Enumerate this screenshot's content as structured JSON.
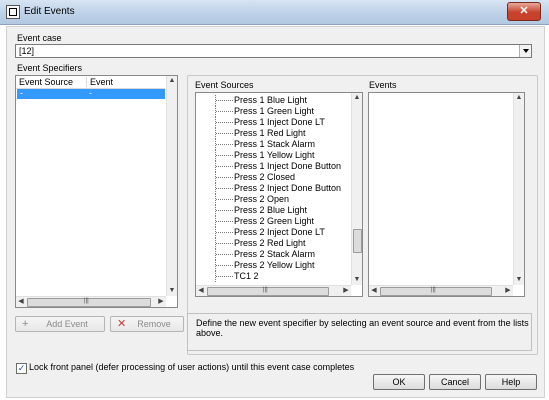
{
  "window": {
    "title": "Edit Events",
    "close_glyph": "✕"
  },
  "event_case": {
    "label": "Event case",
    "value": "[12]"
  },
  "event_specifiers": {
    "label": "Event Specifiers",
    "columns": [
      "Event Source",
      "Event"
    ],
    "rows": [
      {
        "source": "-",
        "event": "-"
      }
    ]
  },
  "event_sources": {
    "label": "Event Sources",
    "items": [
      "Press 1 Blue Light",
      "Press 1 Green Light",
      "Press 1 Inject Done LT",
      "Press 1 Red Light",
      "Press 1 Stack Alarm",
      "Press 1 Yellow Light",
      "Press 1 Inject Done Button",
      "Press 2 Closed",
      "Press 2 Inject Done Button",
      "Press 2 Open",
      "Press 2 Blue Light",
      "Press 2 Green Light",
      "Press 2 Inject Done LT",
      "Press 2 Red Light",
      "Press 2 Stack Alarm",
      "Press 2 Yellow Light",
      "TC1 2"
    ]
  },
  "events": {
    "label": "Events"
  },
  "buttons": {
    "add_event": "Add Event",
    "remove": "Remove",
    "ok": "OK",
    "cancel": "Cancel",
    "help": "Help"
  },
  "info_text": "Define the new event specifier by selecting an event source and event from the lists above.",
  "lock_panel": {
    "label": "Lock front panel (defer processing of user actions) until this event case completes",
    "checked": true
  },
  "colors": {
    "selection": "#3399ff",
    "close_button": "#c7432c"
  }
}
